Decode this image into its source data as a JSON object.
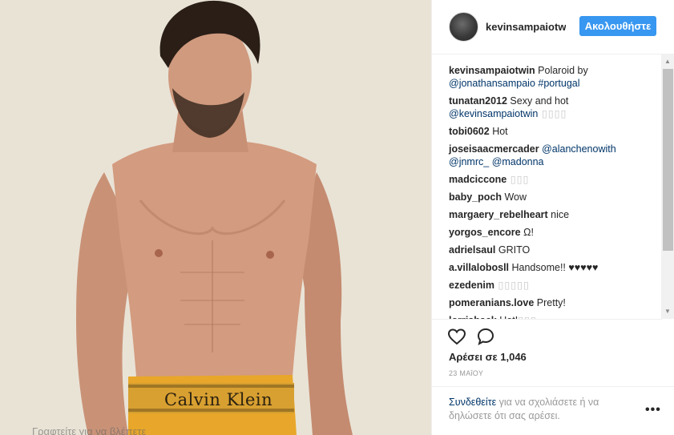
{
  "photo": {
    "alt": "Man wearing Calvin Klein underwear",
    "waistband_text": "Calvin Klein",
    "bottom_strip_text": "Γραφτείτε για να βλέπετε"
  },
  "header": {
    "username": "kevinsampaiotwin",
    "follow_label": "Ακολουθήστε"
  },
  "comments": [
    {
      "user": "kevinsampaiotwin",
      "parts": [
        {
          "t": "text",
          "v": " Polaroid by "
        },
        {
          "t": "link",
          "v": "@jonathansampaio"
        },
        {
          "t": "text",
          "v": " "
        },
        {
          "t": "link",
          "v": "#portugal"
        }
      ]
    },
    {
      "user": "tunatan2012",
      "parts": [
        {
          "t": "text",
          "v": " Sexy and hot "
        },
        {
          "t": "link",
          "v": "@kevinsampaiotwin"
        },
        {
          "t": "boxes",
          "v": " ▯▯▯▯"
        }
      ]
    },
    {
      "user": "tobi0602",
      "parts": [
        {
          "t": "text",
          "v": " Hot"
        }
      ]
    },
    {
      "user": "joseisaacmercader",
      "parts": [
        {
          "t": "text",
          "v": " "
        },
        {
          "t": "link",
          "v": "@alanchenowith"
        },
        {
          "t": "text",
          "v": " "
        },
        {
          "t": "link",
          "v": "@jnmrc_"
        },
        {
          "t": "text",
          "v": " "
        },
        {
          "t": "link",
          "v": "@madonna"
        }
      ]
    },
    {
      "user": "madciccone",
      "parts": [
        {
          "t": "boxes",
          "v": " ▯▯▯"
        }
      ]
    },
    {
      "user": "baby_poch",
      "parts": [
        {
          "t": "text",
          "v": " Wow"
        }
      ]
    },
    {
      "user": "margaery_rebelheart",
      "parts": [
        {
          "t": "text",
          "v": " nice"
        }
      ]
    },
    {
      "user": "yorgos_encore",
      "parts": [
        {
          "t": "text",
          "v": " Ω!"
        }
      ]
    },
    {
      "user": "adrielsaul",
      "parts": [
        {
          "t": "text",
          "v": " GRITO"
        }
      ]
    },
    {
      "user": "a.villalobosll",
      "parts": [
        {
          "t": "text",
          "v": " Handsome!! ♥♥♥♥♥"
        }
      ]
    },
    {
      "user": "ezedenim",
      "parts": [
        {
          "t": "boxes",
          "v": " ▯▯▯▯▯"
        }
      ]
    },
    {
      "user": "pomeranians.love",
      "parts": [
        {
          "t": "text",
          "v": " Pretty!"
        }
      ]
    },
    {
      "user": "lorrishack",
      "parts": [
        {
          "t": "text",
          "v": " Hot!"
        },
        {
          "t": "boxes",
          "v": "▯▯▯"
        }
      ]
    }
  ],
  "actions": {
    "like_icon": "heart-icon",
    "comment_icon": "comment-bubble-icon",
    "likes_text": "Αρέσει σε 1,046",
    "date_text": "23 ΜΑΐΟΥ"
  },
  "footer": {
    "login_link": "Συνδεθείτε",
    "login_rest": " για να σχολιάσετε ή να δηλώσετε ότι σας αρέσει.",
    "more_label": "•••"
  },
  "colors": {
    "accent": "#3897f0",
    "link": "#003569",
    "underwear": "#e8a72a"
  }
}
